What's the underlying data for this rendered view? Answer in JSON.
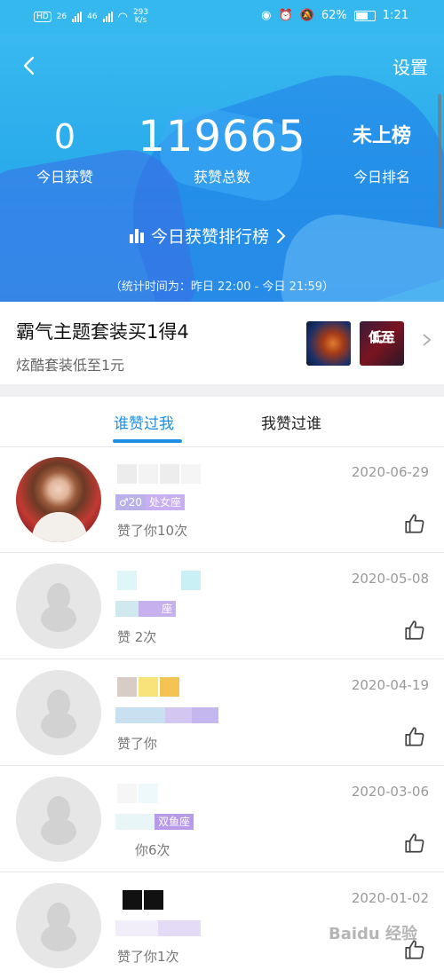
{
  "status_bar": {
    "hd": "HD",
    "net1": "26",
    "net2": "46",
    "speed": "293",
    "speed_unit": "K/s",
    "battery": "62%",
    "time": "1:21"
  },
  "header": {
    "settings": "设置",
    "today_likes_value": "0",
    "today_likes_label": "今日获赞",
    "total_likes_value": "119665",
    "total_likes_label": "获赞总数",
    "today_rank_value": "未上榜",
    "today_rank_label": "今日排名",
    "rank_link": "今日获赞排行榜",
    "stat_time": "（统计时间为：昨日 22:00 - 今日 21:59）"
  },
  "promo": {
    "title": "霸气主题套装买1得4",
    "subtitle": "炫酷套装低至1元",
    "thumb2_text_1": "低至",
    "thumb2_text_2": "1元"
  },
  "tabs": {
    "active": "谁赞过我",
    "inactive": "我赞过谁"
  },
  "list": [
    {
      "date": "2020-06-29",
      "sub": "赞了你10次",
      "tag_1": "♂20",
      "tag_2": "处女座",
      "tag_color": "#c2a7f0",
      "photo": true
    },
    {
      "date": "2020-05-08",
      "sub": "赞    2次",
      "tag_1": "",
      "tag_2": "座",
      "tag_color": "#c7b0ee",
      "photo": false
    },
    {
      "date": "2020-04-19",
      "sub": "赞了你",
      "tag_1": "",
      "tag_2": "",
      "tag_color": "#c9d6f0",
      "photo": false
    },
    {
      "date": "2020-03-06",
      "sub": "你6次",
      "tag_1": "",
      "tag_2": "双鱼座",
      "tag_color": "#b89ae8",
      "photo": false
    },
    {
      "date": "2020-01-02",
      "sub": "赞了你1次",
      "tag_1": "",
      "tag_2": "",
      "tag_color": "#e4dcf6",
      "photo": false
    }
  ],
  "watermark": "Baidu 经验",
  "colors": {
    "header_blue": "#35b8ee",
    "accent_blue": "#1e8fe6",
    "tag_purple": "#c2a7f0"
  }
}
